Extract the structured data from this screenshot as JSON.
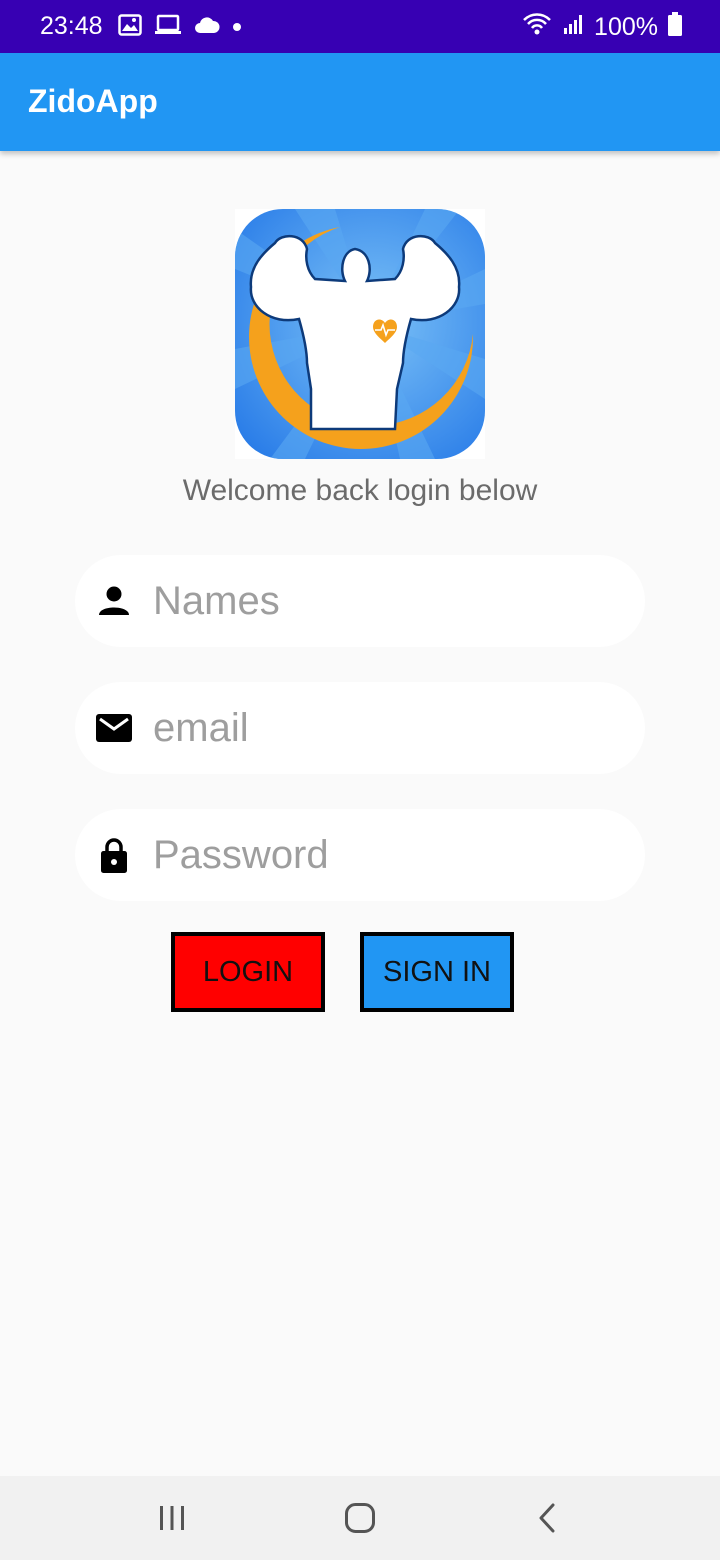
{
  "status_bar": {
    "time": "23:48",
    "battery": "100%",
    "icons": [
      "gallery-icon",
      "laptop-icon",
      "cloud-icon",
      "dot-icon",
      "wifi-icon",
      "signal-icon",
      "battery-icon"
    ]
  },
  "app_bar": {
    "title": "ZidoApp"
  },
  "main": {
    "logo": "muscle-man-logo",
    "welcome_text": "Welcome back login below",
    "fields": {
      "name": {
        "placeholder": "Names",
        "value": "",
        "icon": "person-icon"
      },
      "email": {
        "placeholder": "email",
        "value": "",
        "icon": "mail-icon"
      },
      "password": {
        "placeholder": "Password",
        "value": "",
        "icon": "lock-icon"
      }
    },
    "buttons": {
      "login": {
        "label": "LOGIN",
        "color": "#ff0000"
      },
      "signin": {
        "label": "SIGN IN",
        "color": "#2196f3"
      }
    }
  },
  "colors": {
    "status_bar": "#3700b3",
    "app_bar": "#2196f3",
    "background": "#fafafa"
  },
  "nav_bar": {
    "buttons": [
      "recents-icon",
      "home-icon",
      "back-icon"
    ]
  }
}
